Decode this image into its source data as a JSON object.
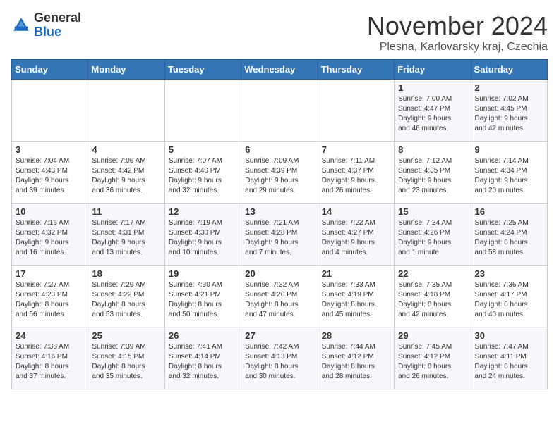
{
  "header": {
    "logo_general": "General",
    "logo_blue": "Blue",
    "month_title": "November 2024",
    "location": "Plesna, Karlovarsky kraj, Czechia"
  },
  "days_of_week": [
    "Sunday",
    "Monday",
    "Tuesday",
    "Wednesday",
    "Thursday",
    "Friday",
    "Saturday"
  ],
  "weeks": [
    [
      {
        "day": "",
        "info": ""
      },
      {
        "day": "",
        "info": ""
      },
      {
        "day": "",
        "info": ""
      },
      {
        "day": "",
        "info": ""
      },
      {
        "day": "",
        "info": ""
      },
      {
        "day": "1",
        "info": "Sunrise: 7:00 AM\nSunset: 4:47 PM\nDaylight: 9 hours\nand 46 minutes."
      },
      {
        "day": "2",
        "info": "Sunrise: 7:02 AM\nSunset: 4:45 PM\nDaylight: 9 hours\nand 42 minutes."
      }
    ],
    [
      {
        "day": "3",
        "info": "Sunrise: 7:04 AM\nSunset: 4:43 PM\nDaylight: 9 hours\nand 39 minutes."
      },
      {
        "day": "4",
        "info": "Sunrise: 7:06 AM\nSunset: 4:42 PM\nDaylight: 9 hours\nand 36 minutes."
      },
      {
        "day": "5",
        "info": "Sunrise: 7:07 AM\nSunset: 4:40 PM\nDaylight: 9 hours\nand 32 minutes."
      },
      {
        "day": "6",
        "info": "Sunrise: 7:09 AM\nSunset: 4:39 PM\nDaylight: 9 hours\nand 29 minutes."
      },
      {
        "day": "7",
        "info": "Sunrise: 7:11 AM\nSunset: 4:37 PM\nDaylight: 9 hours\nand 26 minutes."
      },
      {
        "day": "8",
        "info": "Sunrise: 7:12 AM\nSunset: 4:35 PM\nDaylight: 9 hours\nand 23 minutes."
      },
      {
        "day": "9",
        "info": "Sunrise: 7:14 AM\nSunset: 4:34 PM\nDaylight: 9 hours\nand 20 minutes."
      }
    ],
    [
      {
        "day": "10",
        "info": "Sunrise: 7:16 AM\nSunset: 4:32 PM\nDaylight: 9 hours\nand 16 minutes."
      },
      {
        "day": "11",
        "info": "Sunrise: 7:17 AM\nSunset: 4:31 PM\nDaylight: 9 hours\nand 13 minutes."
      },
      {
        "day": "12",
        "info": "Sunrise: 7:19 AM\nSunset: 4:30 PM\nDaylight: 9 hours\nand 10 minutes."
      },
      {
        "day": "13",
        "info": "Sunrise: 7:21 AM\nSunset: 4:28 PM\nDaylight: 9 hours\nand 7 minutes."
      },
      {
        "day": "14",
        "info": "Sunrise: 7:22 AM\nSunset: 4:27 PM\nDaylight: 9 hours\nand 4 minutes."
      },
      {
        "day": "15",
        "info": "Sunrise: 7:24 AM\nSunset: 4:26 PM\nDaylight: 9 hours\nand 1 minute."
      },
      {
        "day": "16",
        "info": "Sunrise: 7:25 AM\nSunset: 4:24 PM\nDaylight: 8 hours\nand 58 minutes."
      }
    ],
    [
      {
        "day": "17",
        "info": "Sunrise: 7:27 AM\nSunset: 4:23 PM\nDaylight: 8 hours\nand 56 minutes."
      },
      {
        "day": "18",
        "info": "Sunrise: 7:29 AM\nSunset: 4:22 PM\nDaylight: 8 hours\nand 53 minutes."
      },
      {
        "day": "19",
        "info": "Sunrise: 7:30 AM\nSunset: 4:21 PM\nDaylight: 8 hours\nand 50 minutes."
      },
      {
        "day": "20",
        "info": "Sunrise: 7:32 AM\nSunset: 4:20 PM\nDaylight: 8 hours\nand 47 minutes."
      },
      {
        "day": "21",
        "info": "Sunrise: 7:33 AM\nSunset: 4:19 PM\nDaylight: 8 hours\nand 45 minutes."
      },
      {
        "day": "22",
        "info": "Sunrise: 7:35 AM\nSunset: 4:18 PM\nDaylight: 8 hours\nand 42 minutes."
      },
      {
        "day": "23",
        "info": "Sunrise: 7:36 AM\nSunset: 4:17 PM\nDaylight: 8 hours\nand 40 minutes."
      }
    ],
    [
      {
        "day": "24",
        "info": "Sunrise: 7:38 AM\nSunset: 4:16 PM\nDaylight: 8 hours\nand 37 minutes."
      },
      {
        "day": "25",
        "info": "Sunrise: 7:39 AM\nSunset: 4:15 PM\nDaylight: 8 hours\nand 35 minutes."
      },
      {
        "day": "26",
        "info": "Sunrise: 7:41 AM\nSunset: 4:14 PM\nDaylight: 8 hours\nand 32 minutes."
      },
      {
        "day": "27",
        "info": "Sunrise: 7:42 AM\nSunset: 4:13 PM\nDaylight: 8 hours\nand 30 minutes."
      },
      {
        "day": "28",
        "info": "Sunrise: 7:44 AM\nSunset: 4:12 PM\nDaylight: 8 hours\nand 28 minutes."
      },
      {
        "day": "29",
        "info": "Sunrise: 7:45 AM\nSunset: 4:12 PM\nDaylight: 8 hours\nand 26 minutes."
      },
      {
        "day": "30",
        "info": "Sunrise: 7:47 AM\nSunset: 4:11 PM\nDaylight: 8 hours\nand 24 minutes."
      }
    ]
  ]
}
